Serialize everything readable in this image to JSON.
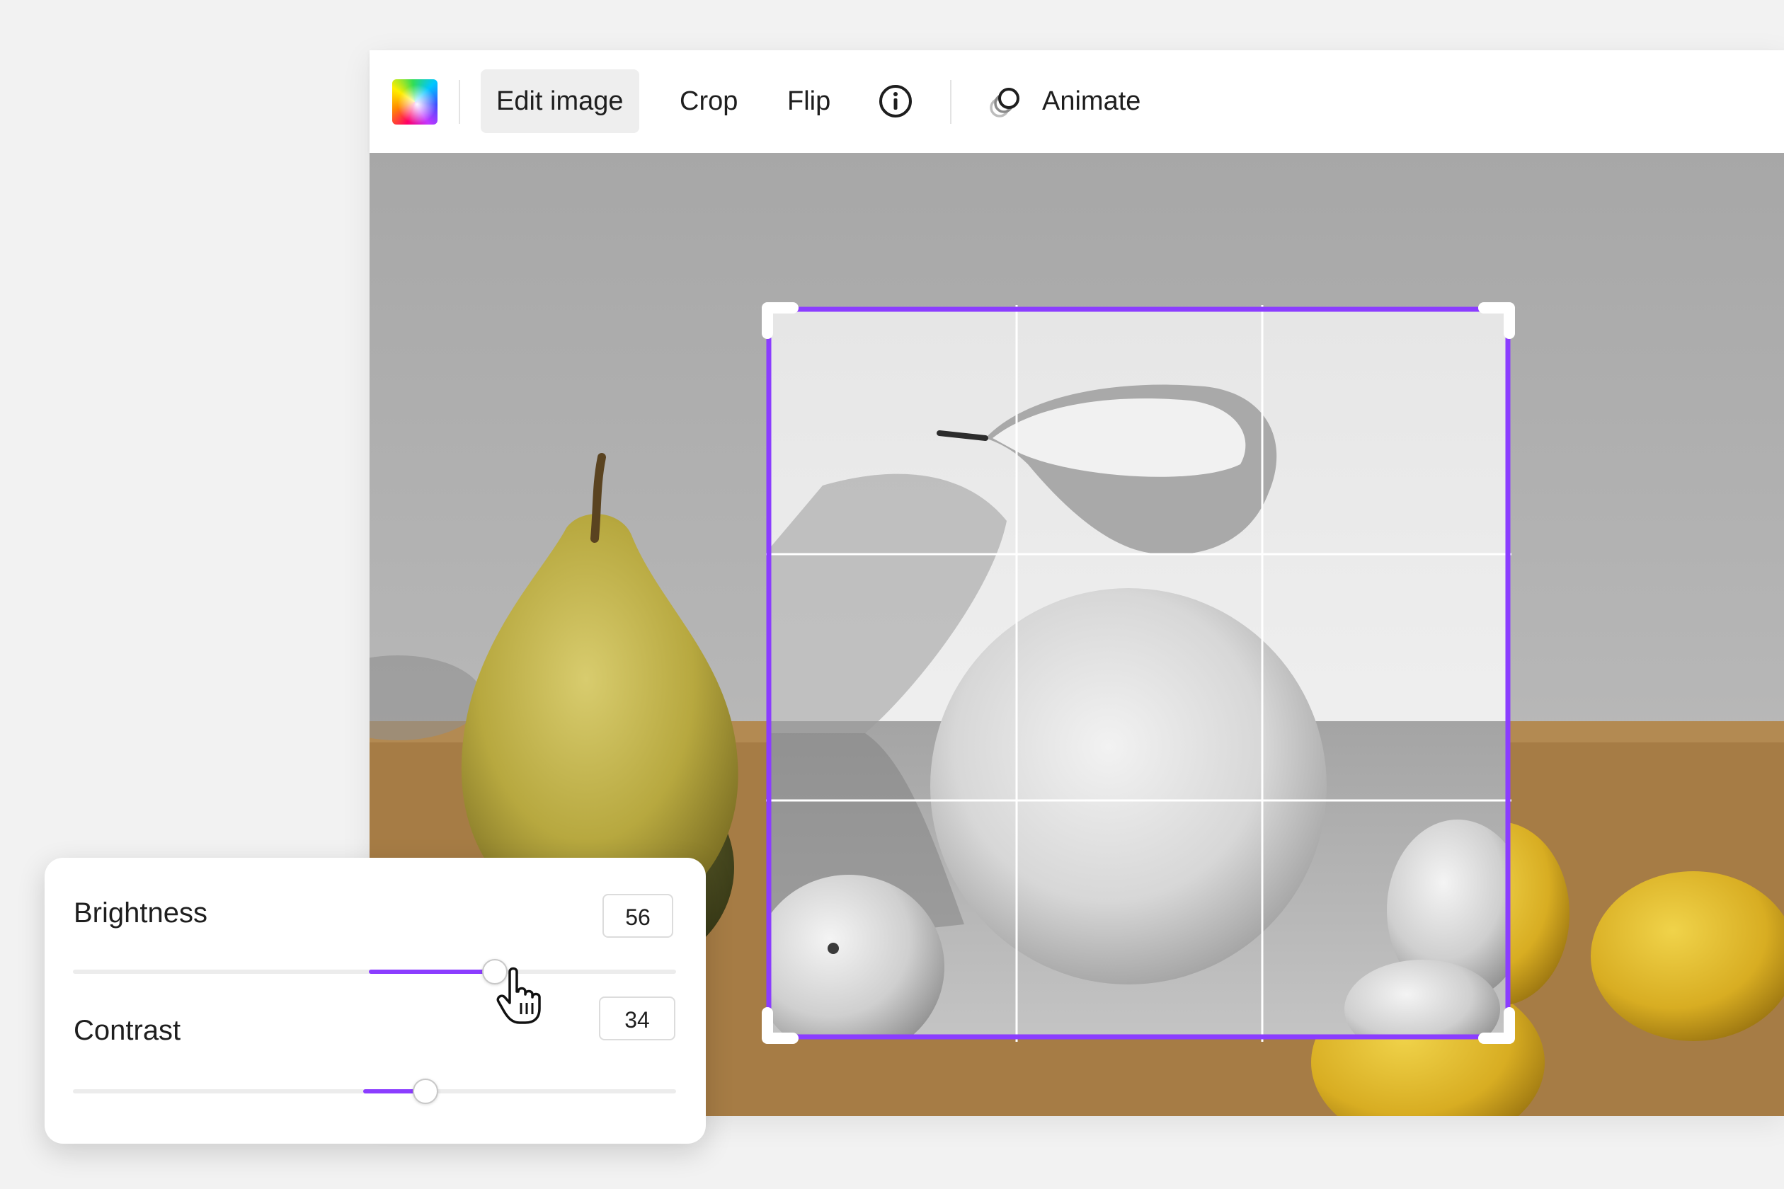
{
  "toolbar": {
    "color_icon": "color-swatch-icon",
    "edit_image_label": "Edit image",
    "crop_label": "Crop",
    "flip_label": "Flip",
    "info_icon": "info-icon",
    "animate_icon": "animate-icon",
    "animate_label": "Animate"
  },
  "crop_frame": {
    "color": "#8b3dff",
    "grid": "3x3"
  },
  "adjustments": {
    "brightness": {
      "label": "Brightness",
      "value": "56",
      "fill_start": 0.491,
      "level": 0.7
    },
    "contrast": {
      "label": "Contrast",
      "value": "34",
      "fill_start": 0.481,
      "level": 0.585
    }
  },
  "colors": {
    "accent": "#8b3dff",
    "panel_bg": "#ffffff",
    "page_bg": "#f2f2f2"
  }
}
